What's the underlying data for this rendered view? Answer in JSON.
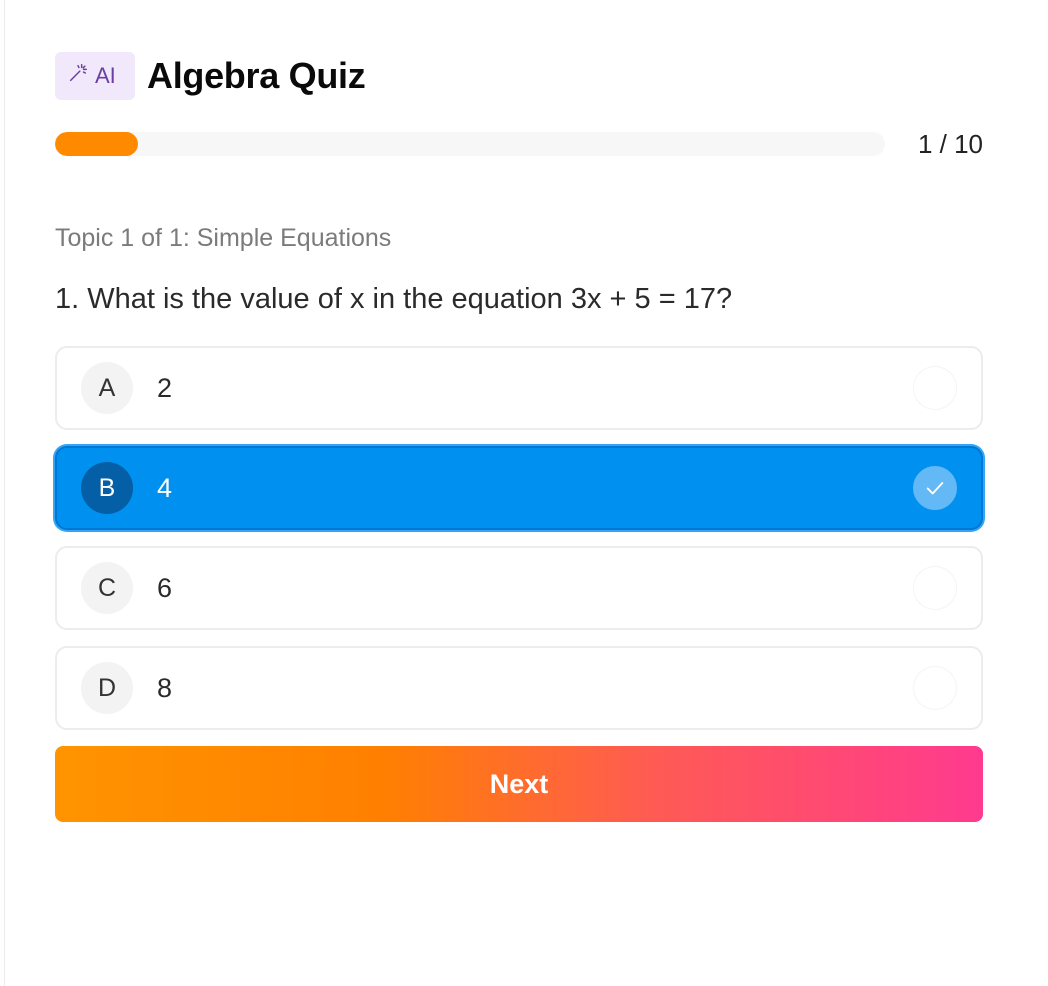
{
  "header": {
    "badge_label": "AI",
    "badge_icon": "magic-wand-icon",
    "title": "Algebra Quiz"
  },
  "progress": {
    "current": 1,
    "total": 10,
    "label": "1 / 10",
    "fraction": 0.1,
    "color": "#ff8a00"
  },
  "topic": "Topic 1 of 1: Simple Equations",
  "question": "1. What is the value of x in the equation 3x + 5 = 17?",
  "options": [
    {
      "letter": "A",
      "text": "2",
      "selected": false
    },
    {
      "letter": "B",
      "text": "4",
      "selected": true
    },
    {
      "letter": "C",
      "text": "6",
      "selected": false
    },
    {
      "letter": "D",
      "text": "8",
      "selected": false
    }
  ],
  "next_label": "Next",
  "colors": {
    "selected": "#0090ef",
    "accent_purple": "#6b3fa0",
    "button_gradient_start": "#ff9400",
    "button_gradient_end": "#ff3a8f"
  }
}
